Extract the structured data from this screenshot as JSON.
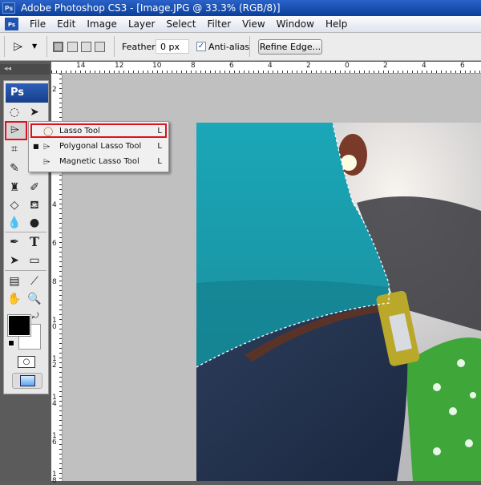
{
  "window": {
    "title": "Adobe Photoshop CS3 - [Image.JPG @ 33.3% (RGB/8)]",
    "logo": "Ps"
  },
  "menu": [
    "File",
    "Edit",
    "Image",
    "Layer",
    "Select",
    "Filter",
    "View",
    "Window",
    "Help"
  ],
  "options": {
    "feather_label": "Feather:",
    "feather_value": "0 px",
    "anti_alias_label": "Anti-alias",
    "anti_alias_checked": true,
    "refine_edge": "Refine Edge..."
  },
  "panel": {
    "collapse": "◂◂",
    "logo": "Ps"
  },
  "ruler": {
    "top": [
      "14",
      "12",
      "10",
      "8",
      "6",
      "4",
      "2",
      "0",
      "2",
      "4",
      "6"
    ],
    "left": [
      "2",
      "4",
      "6",
      "8",
      "10",
      "12",
      "14",
      "16",
      "18"
    ]
  },
  "flyout": [
    {
      "label": "Lasso Tool",
      "key": "L",
      "active": true
    },
    {
      "label": "Polygonal Lasso Tool",
      "key": "L",
      "active": false
    },
    {
      "label": "Magnetic Lasso Tool",
      "key": "L",
      "active": false
    }
  ],
  "colors": {
    "highlight": "#e0101c",
    "title_bar": "#0b3f9a",
    "canvas": "#c0c0c0",
    "foreground": "#000000",
    "background": "#ffffff"
  }
}
